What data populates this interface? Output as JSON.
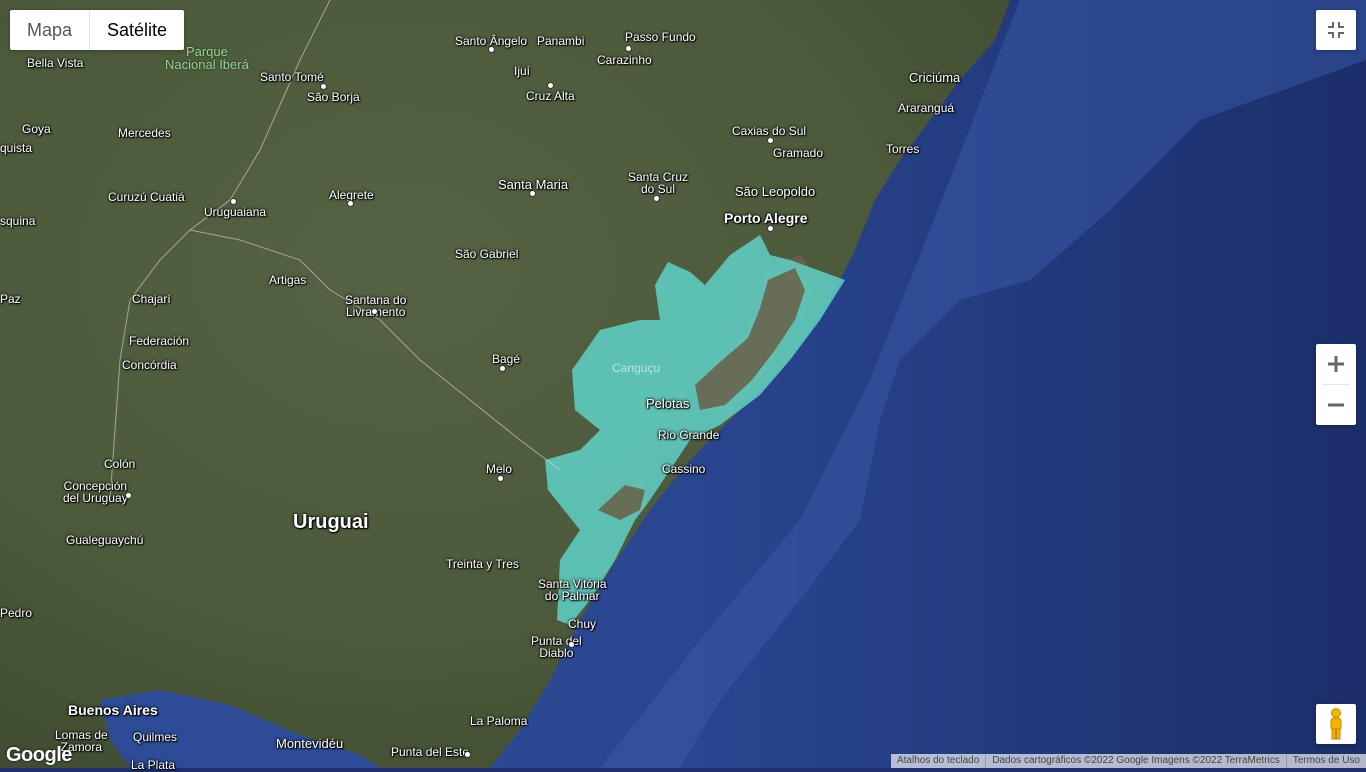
{
  "map_type": {
    "map": "Mapa",
    "satellite": "Satélite",
    "selected": "satellite"
  },
  "controls": {
    "fullscreen": "exit-fullscreen-icon",
    "zoom_in": "plus-icon",
    "zoom_out": "minus-icon",
    "street_view": "pegman-icon"
  },
  "labels": {
    "santo_angelo": "Santo Ângelo",
    "panambi": "Panambi",
    "passo_fundo": "Passo Fundo",
    "carazinho": "Carazinho",
    "ijui": "Ijuí",
    "cruz_alta": "Cruz Alta",
    "parque": "Parque\nNacional Iberá",
    "bella_vista": "Bella Vista",
    "santo_tome": "Santo Tomé",
    "sao_borja": "São Borja",
    "criciuma": "Criciúma",
    "ararangua": "Araranguá",
    "torres": "Torres",
    "goya": "Goya",
    "esquina": "quista",
    "mercedes": "Mercedes",
    "caxias": "Caxias do Sul",
    "gramado": "Gramado",
    "santa_maria": "Santa Maria",
    "santa_cruz": "Santa Cruz\ndo Sul",
    "sao_leopoldo": "São Leopoldo",
    "porto_alegre": "Porto Alegre",
    "curuzu": "Curuzú Cuatiá",
    "uruguaiana": "Uruguaiana",
    "alegrete": "Alegrete",
    "esquina2": "squina",
    "sao_gabriel": "São Gabriel",
    "artigas": "Artigas",
    "chajari": "Chajarí",
    "santana": "Santana do\nLivramento",
    "paz": "Paz",
    "federacion": "Federación",
    "concordia": "Concórdia",
    "bage": "Bagé",
    "cangucu": "Canguçu",
    "pelotas": "Pelotas",
    "rio_grande": "Rio Grande",
    "cassino": "Cassino",
    "colon": "Colón",
    "concepcion": "Concepción\ndel Uruguay",
    "melo": "Melo",
    "uruguai": "Uruguai",
    "gualeguaychu": "Gualeguaychú",
    "treinta": "Treinta y Tres",
    "santa_vitoria": "Santa Vitória\ndo Palmar",
    "chuy": "Chuy",
    "pedro": "Pedro",
    "punta_diablo": "Punta del\nDiablo",
    "buenos_aires": "Buenos Aires",
    "lomas": "Lomas de\nZamora",
    "quilmes": "Quilmes",
    "la_plata": "La Plata",
    "la_paloma": "La Paloma",
    "montevideu": "Montevidéu",
    "punta_este": "Punta del Este"
  },
  "logo": "Google",
  "footer": {
    "shortcuts": "Atalhos do teclado",
    "attribution": "Dados cartográficos ©2022 Google Imagens ©2022 TerraMetrics",
    "terms": "Termos de Uso"
  },
  "colors": {
    "ocean": "#2a4690",
    "land": "#4a5a3c",
    "highlight": "#5fd6cc"
  }
}
